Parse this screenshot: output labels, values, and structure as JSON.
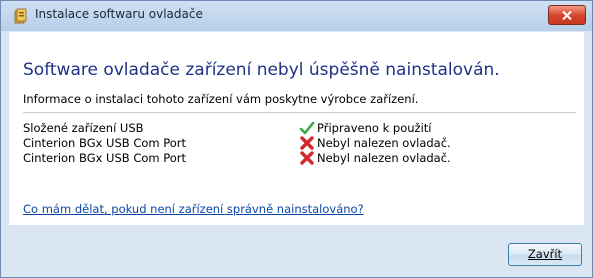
{
  "window": {
    "title": "Instalace softwaru ovladače",
    "app_icon": "driver-package-icon",
    "close_icon": "close-icon"
  },
  "main": {
    "heading": "Software ovladače zařízení nebyl úspěšně nainstalován.",
    "info": "Informace o instalaci tohoto zařízení vám poskytne výrobce zařízení.",
    "devices": [
      {
        "name": "Složené zařízení USB",
        "status": "Připraveno k použití",
        "status_icon": "checkmark-icon",
        "status_color": "#3aa84a"
      },
      {
        "name": "Cinterion BGx USB Com Port",
        "status": "Nebyl nalezen ovladač.",
        "status_icon": "error-x-icon",
        "status_color": "#d2282b"
      },
      {
        "name": "Cinterion BGx USB Com Port",
        "status": "Nebyl nalezen ovladač.",
        "status_icon": "error-x-icon",
        "status_color": "#d2282b"
      }
    ],
    "help_link": "Co mám dělat, pokud není zařízení správně nainstalováno?"
  },
  "footer": {
    "close_button": "Zavřít"
  },
  "colors": {
    "heading": "#1e3287",
    "link": "#0b47a8",
    "frame": "#dbe6f3",
    "close_red": "#d4432a"
  }
}
